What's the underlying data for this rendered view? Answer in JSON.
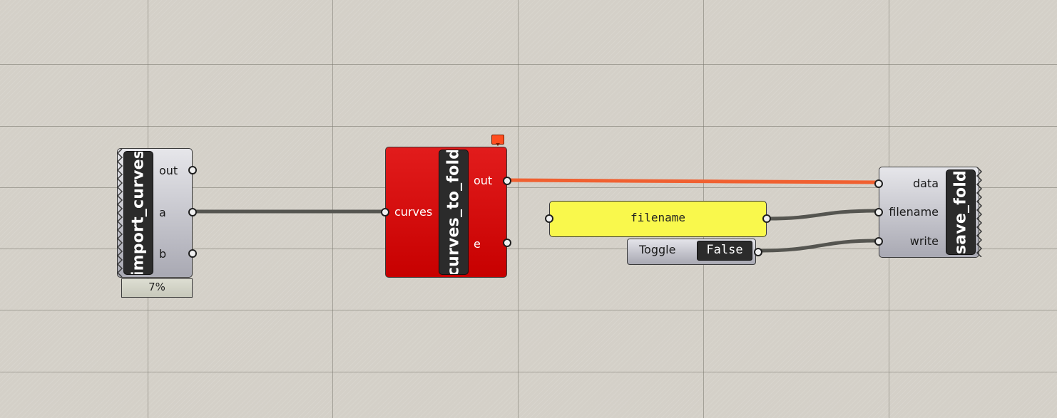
{
  "canvas": {
    "background_color": "#d4d0c8",
    "grid_color": "#8c8a82"
  },
  "components": {
    "import_curves": {
      "name": "import_curves",
      "outputs": [
        "out",
        "a",
        "b"
      ],
      "progress_label": "7%",
      "progress": 0.07,
      "color": "#b0b0ba"
    },
    "curves_to_fold": {
      "name": "curves_to_fold",
      "inputs": [
        "curves"
      ],
      "outputs": [
        "out",
        "e"
      ],
      "color": "#d40000",
      "state": "error"
    },
    "filename_panel": {
      "text": "filename",
      "color": "#f9f84c"
    },
    "toggle": {
      "label": "Toggle",
      "value": "False"
    },
    "save_fold": {
      "name": "save_fold",
      "inputs": [
        "data",
        "filename",
        "write"
      ],
      "color": "#b0b0ba"
    }
  },
  "wires": {
    "plain_color": "#555550",
    "error_color": "#f06030"
  },
  "icons": {
    "message_flag": "message-balloon-icon",
    "param_edge": "zigzag-edge"
  }
}
